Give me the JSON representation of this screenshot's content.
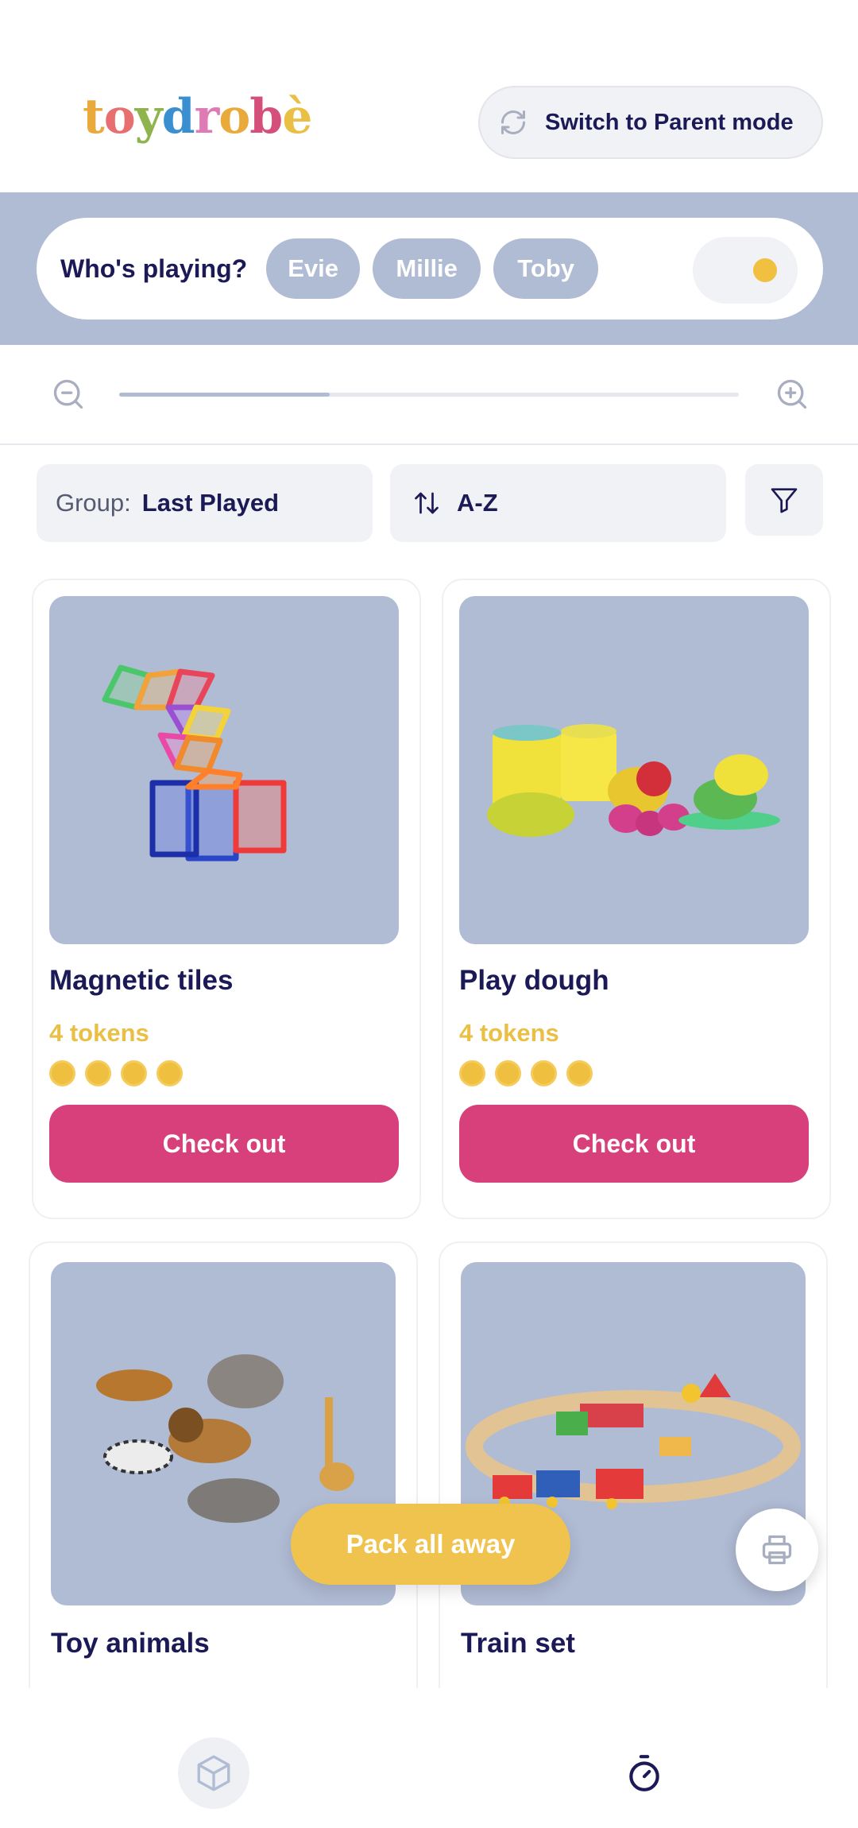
{
  "app": {
    "logo_letters": [
      {
        "ch": "t",
        "color": "#e9a93b"
      },
      {
        "ch": "o",
        "color": "#e86f6f"
      },
      {
        "ch": "y",
        "color": "#8fb44d"
      },
      {
        "ch": "d",
        "color": "#3a8fd1"
      },
      {
        "ch": "r",
        "color": "#e07ab5"
      },
      {
        "ch": "o",
        "color": "#e9a93b"
      },
      {
        "ch": "b",
        "color": "#d44f7a"
      },
      {
        "ch": "è",
        "color": "#e9bf45"
      }
    ]
  },
  "header": {
    "parent_mode_label": "Switch to Parent mode"
  },
  "players": {
    "label": "Who's playing?",
    "names": [
      "Evie",
      "Millie",
      "Toby"
    ]
  },
  "zoom": {
    "level": 0.34
  },
  "controls": {
    "group_key": "Group:",
    "group_value": "Last Played",
    "sort_label": "A-Z"
  },
  "toys": [
    {
      "name": "Magnetic tiles",
      "tokens": "4 tokens",
      "token_count": 4,
      "action": "Check out",
      "image": "magnetic-tiles"
    },
    {
      "name": "Play dough",
      "tokens": "4 tokens",
      "token_count": 4,
      "action": "Check out",
      "image": "play-dough"
    },
    {
      "name": "Toy animals",
      "image": "toy-animals"
    },
    {
      "name": "Train set",
      "image": "train-set"
    }
  ],
  "floating": {
    "pack_label": "Pack all away"
  },
  "colors": {
    "accent_pink": "#d8407c",
    "token_yellow": "#efbf40",
    "band_blue": "#b0bbd4",
    "navy": "#1b1a57"
  },
  "icons": [
    "refresh-icon",
    "coin-icon",
    "zoom-out-icon",
    "zoom-in-icon",
    "sort-icon",
    "filter-icon",
    "print-icon",
    "box-icon",
    "timer-icon"
  ]
}
